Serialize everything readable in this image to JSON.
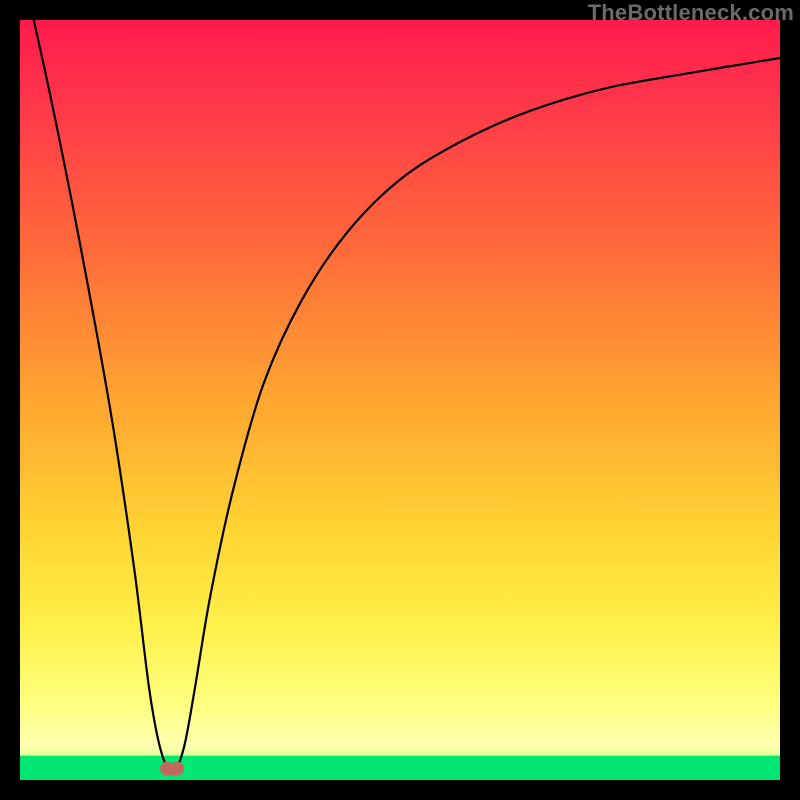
{
  "watermark": "TheBottleneck.com",
  "chart_data": {
    "type": "line",
    "title": "",
    "xlabel": "",
    "ylabel": "",
    "xlim": [
      0,
      100
    ],
    "ylim": [
      0,
      100
    ],
    "series": [
      {
        "name": "curve",
        "x": [
          0,
          4,
          8,
          12,
          15,
          17,
          18.5,
          20,
          21.5,
          23,
          25,
          28,
          32,
          37,
          43,
          50,
          58,
          67,
          77,
          88,
          100
        ],
        "values": [
          108,
          90,
          70,
          48,
          28,
          12,
          4,
          1,
          4,
          12,
          24,
          38,
          52,
          63,
          72,
          79,
          84,
          88,
          91,
          93,
          95
        ]
      }
    ],
    "bottom_band_top": 3.2,
    "marker": {
      "x": 20,
      "y": 1.5,
      "shape": "bilobe",
      "color": "#c06a5e"
    },
    "gradient_stops": [
      {
        "offset": 0.0,
        "color": "#ff1a4d"
      },
      {
        "offset": 0.12,
        "color": "#ff3a49"
      },
      {
        "offset": 0.3,
        "color": "#ff6a3a"
      },
      {
        "offset": 0.5,
        "color": "#ffa531"
      },
      {
        "offset": 0.68,
        "color": "#ffd633"
      },
      {
        "offset": 0.8,
        "color": "#fff04a"
      },
      {
        "offset": 0.9,
        "color": "#ffff80"
      },
      {
        "offset": 0.955,
        "color": "#ffffb0"
      },
      {
        "offset": 0.972,
        "color": "#d8ff8e"
      },
      {
        "offset": 0.985,
        "color": "#66ff66"
      },
      {
        "offset": 1.0,
        "color": "#00e873"
      }
    ]
  }
}
